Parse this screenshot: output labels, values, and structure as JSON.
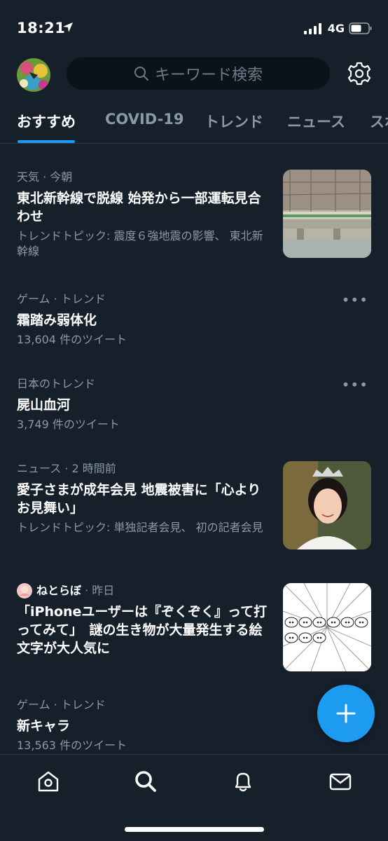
{
  "status_bar": {
    "time": "18:21",
    "network": "4G"
  },
  "search": {
    "placeholder": "キーワード検索"
  },
  "tabs": [
    {
      "label": "おすすめ",
      "active": true
    },
    {
      "label": "COVID-19",
      "active": false
    },
    {
      "label": "トレンド",
      "active": false
    },
    {
      "label": "ニュース",
      "active": false
    },
    {
      "label": "スポ",
      "active": false
    }
  ],
  "trends": [
    {
      "category": "天気",
      "time": "今朝",
      "title": "東北新幹線で脱線 始発から一部運転見合わせ",
      "description": "トレンドトピック: 震度６強地震の影響、 東北新幹線"
    },
    {
      "category": "ゲーム · トレンド",
      "title": "霜踏み弱体化",
      "count": "13,604 件のツイート"
    },
    {
      "category": "日本のトレンド",
      "title": "屍山血河",
      "count": "3,749 件のツイート"
    },
    {
      "category": "ニュース",
      "time": "2 時間前",
      "title": "愛子さまが成年会見 地震被害に「心よりお見舞い」",
      "description": "トレンドトピック: 単独記者会見、 初の記者会見"
    },
    {
      "category": "ねとらぼ",
      "time": "昨日",
      "title": "「iPhoneユーザーは『ぞくぞく』って打ってみて」　謎の生き物が大量発生する絵文字が大人気に"
    },
    {
      "category": "ゲーム · トレンド",
      "title": "新キャラ",
      "count": "13,563 件のツイート"
    }
  ],
  "colors": {
    "background": "#15202b",
    "accent": "#1d9bf0",
    "muted": "#8b98a5"
  },
  "icons": [
    "location-arrow-icon",
    "signal-icon",
    "battery-icon",
    "search-icon",
    "gear-icon",
    "more-icon",
    "plus-icon",
    "home-icon",
    "search-icon",
    "bell-icon",
    "mail-icon"
  ]
}
